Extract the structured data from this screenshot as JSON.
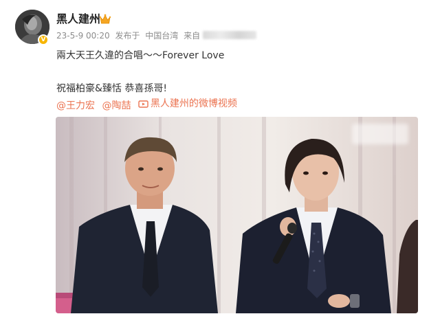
{
  "post": {
    "author": {
      "name": "黑人建州",
      "avatar_icon": "avatar-photo",
      "badge_icon": "verified-icon",
      "crown_icon": "crown-icon"
    },
    "meta": {
      "time": "23-5-9 00:20",
      "published_in": "发布于",
      "location": "中国台湾",
      "source_prefix": "来自"
    },
    "text": {
      "line1": "兩大天王久違的合唱～～Forever Love",
      "line2": "祝福柏豪&臻恬 恭喜孫哥!"
    },
    "links": {
      "mention1": "@王力宏",
      "mention2": "@陶喆",
      "video": "黑人建州的微博视频",
      "video_icon": "video-icon"
    },
    "accent_color": "#eb7350",
    "badge_color": "#f7b500"
  }
}
